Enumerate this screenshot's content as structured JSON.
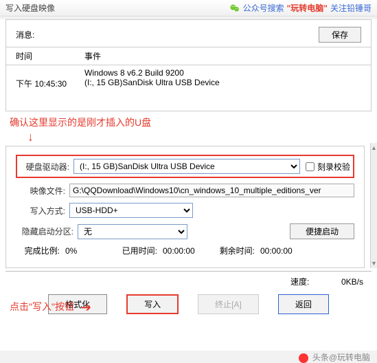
{
  "header": {
    "title": "写入硬盘映像",
    "search_label": "公众号搜索",
    "brand": "\"玩转电脑\"",
    "follow": "关注铅锤哥"
  },
  "top": {
    "message_label": "消息:",
    "save_label": "保存"
  },
  "log": {
    "col_time": "时间",
    "col_event": "事件",
    "rows": [
      {
        "time": "",
        "event": "Windows 8 v6.2 Build 9200"
      },
      {
        "time": "下午 10:45:30",
        "event": "(I:, 15 GB)SanDisk Ultra USB Device"
      }
    ]
  },
  "annot1": "确认这里显示的是刚才插入的U盘",
  "annot2": "点击\"写入\"按钮",
  "form": {
    "drive_label": "硬盘驱动器:",
    "drive_value": "(I:, 15 GB)SanDisk Ultra USB Device",
    "burn_check_label": "刻录校验",
    "image_label": "映像文件:",
    "image_value": "G:\\QQDownload\\Windows10\\cn_windows_10_multiple_editions_ver",
    "write_mode_label": "写入方式:",
    "write_mode_value": "USB-HDD+",
    "hidden_label": "隐藏启动分区:",
    "hidden_value": "无",
    "portable_label": "便捷启动"
  },
  "progress": {
    "ratio_label": "完成比例:",
    "ratio_value": "0%",
    "elapsed_label": "已用时间:",
    "elapsed_value": "00:00:00",
    "remain_label": "剩余时间:",
    "remain_value": "00:00:00",
    "speed_label": "速度:",
    "speed_value": "0KB/s"
  },
  "buttons": {
    "format": "格式化",
    "write": "写入",
    "stop": "终止[A]",
    "back": "返回"
  },
  "footer": "头条@玩转电脑"
}
